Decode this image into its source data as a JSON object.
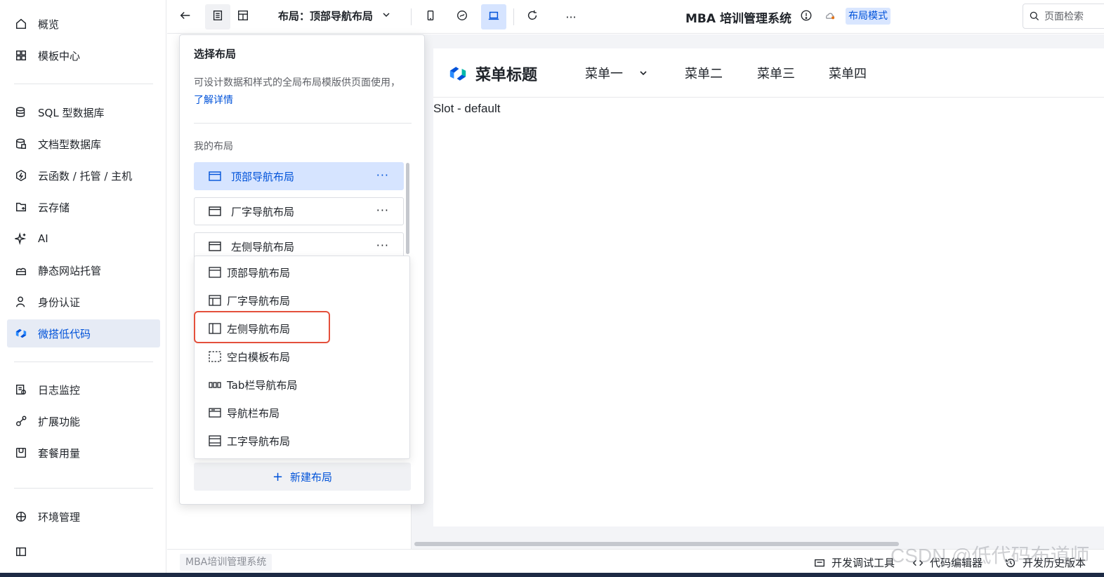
{
  "sidebar": {
    "items": [
      {
        "label": "概览",
        "icon": "home-icon"
      },
      {
        "label": "模板中心",
        "icon": "grid-icon"
      },
      {
        "label": "SQL 型数据库",
        "icon": "database-icon"
      },
      {
        "label": "文档型数据库",
        "icon": "document-database-icon"
      },
      {
        "label": "云函数 / 托管 / 主机",
        "icon": "function-icon"
      },
      {
        "label": "云存储",
        "icon": "storage-icon"
      },
      {
        "label": "AI",
        "icon": "sparkle-icon"
      },
      {
        "label": "静态网站托管",
        "icon": "hosting-icon"
      },
      {
        "label": "身份认证",
        "icon": "user-icon"
      },
      {
        "label": "微搭低代码",
        "icon": "weda-logo-icon"
      },
      {
        "label": "日志监控",
        "icon": "log-icon"
      },
      {
        "label": "扩展功能",
        "icon": "extension-icon"
      },
      {
        "label": "套餐用量",
        "icon": "package-icon"
      },
      {
        "label": "环境管理",
        "icon": "environment-icon"
      },
      {
        "label": "",
        "icon": "collapse-sidebar-icon"
      }
    ],
    "active_label": "微搭低代码"
  },
  "toolbar": {
    "layout_title": "布局：顶部导航布局",
    "app_title": "MBA 培训管理系统",
    "mode_badge": "布局模式",
    "search_label": "页面检索",
    "more_label": "···"
  },
  "popover": {
    "title": "选择布局",
    "desc": "可设计数据和样式的全局布局模版供页面使用，",
    "desc_link": "了解详情",
    "section_label": "我的布局",
    "my_layouts": [
      {
        "label": "顶部导航布局",
        "more": "···",
        "selected": true
      },
      {
        "label": "厂字导航布局",
        "more": "···",
        "selected": false
      },
      {
        "label": "左侧导航布局",
        "more": "···",
        "selected": false
      }
    ],
    "new_button": "新建布局",
    "new_button_icon": "+"
  },
  "dropdown": {
    "options": [
      {
        "label": "顶部导航布局",
        "icon": "top-nav-layout-icon"
      },
      {
        "label": "厂字导航布局",
        "icon": "l-shape-layout-icon"
      },
      {
        "label": "左侧导航布局",
        "icon": "left-nav-layout-icon",
        "highlighted": true
      },
      {
        "label": "空白模板布局",
        "icon": "blank-layout-icon"
      },
      {
        "label": "Tab栏导航布局",
        "icon": "tab-bar-layout-icon"
      },
      {
        "label": "导航栏布局",
        "icon": "navbar-layout-icon"
      },
      {
        "label": "工字导航布局",
        "icon": "i-shape-layout-icon"
      }
    ]
  },
  "preview": {
    "brand_title": "菜单标题",
    "menus": [
      "菜单一",
      "菜单二",
      "菜单三",
      "菜单四"
    ],
    "slot_text": "Slot - default"
  },
  "statusbar": {
    "app_name": "MBA培训管理系统",
    "dev_tools": "开发调试工具",
    "code_editor": "代码编辑器",
    "history": "开发历史版本"
  },
  "watermark": "CSDN @低代码布道师",
  "colors": {
    "accent": "#0052d9",
    "selected_bg": "#d6e4ff",
    "highlight_border": "#e4503c",
    "workspace_bg": "#f3f4f7"
  }
}
